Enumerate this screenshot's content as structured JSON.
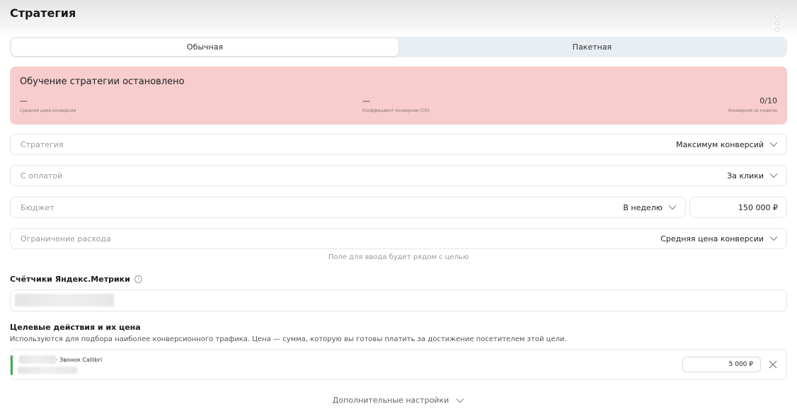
{
  "header": {
    "title": "Стратегия"
  },
  "mode_tabs": [
    {
      "label": "Обычная",
      "active": true
    },
    {
      "label": "Пакетная",
      "active": false
    }
  ],
  "alert": {
    "title": "Обучение стратегии остановлено",
    "metrics": [
      {
        "value": "—",
        "label": "Средняя цена конверсии"
      },
      {
        "value": "—",
        "label": "Коэффициент конверсии (CR)"
      },
      {
        "value": "0/10",
        "label": "Конверсий за неделю"
      }
    ],
    "background_color": "#f7cdcd"
  },
  "fields": {
    "strategy": {
      "label": "Стратегия",
      "value": "Максимум конверсий"
    },
    "payment": {
      "label": "С оплатой",
      "value": "За клики"
    },
    "budget": {
      "label": "Бюджет",
      "period": "В неделю",
      "amount": "150 000 ₽"
    },
    "spend_limit": {
      "label": "Ограничение расхода",
      "value": "Средняя цена конверсии"
    }
  },
  "hint": "Поле для ввода будет рядом с целью",
  "metrika": {
    "title": "Счётчики Яндекс.Метрики"
  },
  "goals": {
    "title": "Целевые действия и их цена",
    "description": "Используются для подбора наиболее конверсионного трафика. Цена — сумма, которую вы готовы платить за достижение посетителем этой цели.",
    "items": [
      {
        "name": "· Звонок Callibri",
        "price": "5 000 ₽",
        "accent_color": "#3cb04a"
      }
    ]
  },
  "footer": {
    "more_settings_label": "Дополнительные настройки"
  }
}
